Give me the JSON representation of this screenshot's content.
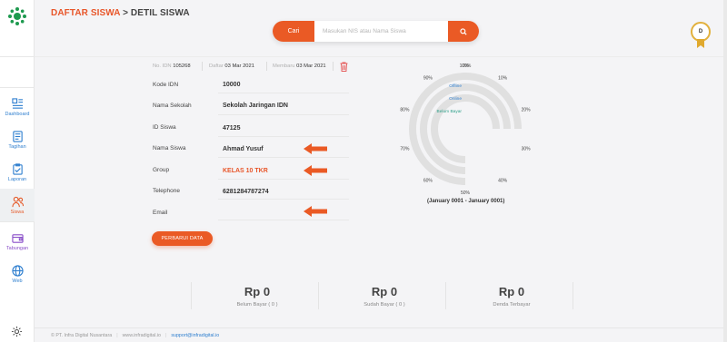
{
  "sidebar": {
    "items": [
      {
        "label": "Dashboard",
        "icon": "dashboard-icon"
      },
      {
        "label": "Tagihan",
        "icon": "bill-icon"
      },
      {
        "label": "Laporan",
        "icon": "report-icon"
      },
      {
        "label": "Siswa",
        "icon": "students-icon",
        "active": true
      },
      {
        "label": "Tabungan",
        "icon": "savings-icon"
      },
      {
        "label": "Web",
        "icon": "globe-icon"
      }
    ]
  },
  "header": {
    "breadcrumb_link": "DAFTAR SISWA",
    "breadcrumb_sep": " > ",
    "breadcrumb_current": "DETIL SISWA"
  },
  "search": {
    "button_label": "Cari",
    "placeholder": "Masukan NIS atau Nama Siswa"
  },
  "user": {
    "initial": "D"
  },
  "meta": {
    "idn_label": "No. IDN",
    "idn_value": "105268",
    "daftar_label": "Daftar",
    "daftar_value": "03 Mar 2021",
    "membaru_label": "Membaru",
    "membaru_value": "03 Mar 2021"
  },
  "form": {
    "rows": [
      {
        "label": "Kode IDN",
        "value": "10000"
      },
      {
        "label": "Nama Sekolah",
        "value": "Sekolah Jaringan IDN"
      },
      {
        "label": "ID Siswa",
        "value": "47125"
      },
      {
        "label": "Nama Siswa",
        "value": "Ahmad Yusuf"
      },
      {
        "label": "Group",
        "value": "KELAS 10 TKR"
      },
      {
        "label": "Telephone",
        "value": "6281284787274"
      },
      {
        "label": "Email",
        "value": ""
      }
    ],
    "update_button": "PERBARUI DATA"
  },
  "chart_data": {
    "type": "radial-bar",
    "legend": [
      "Offline",
      "Online",
      "Belum Bayar"
    ],
    "axis_ticks": [
      "0%",
      "10%",
      "20%",
      "30%",
      "40%",
      "50%",
      "60%",
      "70%",
      "80%",
      "90%",
      "100%"
    ],
    "values": [
      75,
      75,
      75
    ],
    "colors": [
      "#e0e0e0",
      "#e0e0e0",
      "#e0e0e0"
    ],
    "caption": "(January 0001 - January 0001)"
  },
  "summary": [
    {
      "value": "Rp 0",
      "label": "Belum Bayar ( 0 )"
    },
    {
      "value": "Rp 0",
      "label": "Sudah Bayar ( 0 )"
    },
    {
      "value": "Rp 0",
      "label": "Denda Terbayar"
    }
  ],
  "footer": {
    "copyright": "© PT. Infra Digital Nusantara",
    "website": "www.infradigital.io",
    "email": "support@infradigital.io"
  },
  "colors": {
    "accent": "#ea5a25",
    "link": "#2f7fcf",
    "logo": "#1e9a4f"
  }
}
